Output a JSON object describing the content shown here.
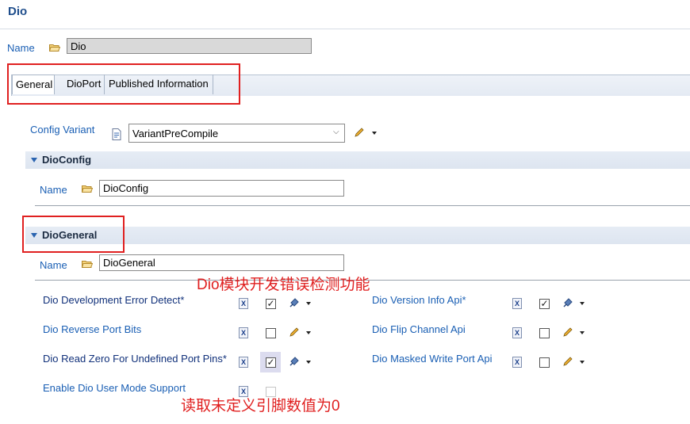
{
  "window": {
    "title": "Dio"
  },
  "name_field": {
    "label": "Name",
    "value": "Dio"
  },
  "tabs": [
    {
      "label": "General"
    },
    {
      "label": "DioPort"
    },
    {
      "label": "Published Information"
    }
  ],
  "config_variant": {
    "label": "Config Variant",
    "value": "VariantPreCompile"
  },
  "dioconfig": {
    "title": "DioConfig",
    "name_label": "Name",
    "name_value": "DioConfig"
  },
  "diogeneral": {
    "title": "DioGeneral",
    "name_label": "Name",
    "name_value": "DioGeneral"
  },
  "params": {
    "dev_error_detect": {
      "label": "Dio Development Error Detect*",
      "checked": true
    },
    "version_info_api": {
      "label": "Dio Version Info Api*",
      "checked": true
    },
    "reverse_port_bits": {
      "label": "Dio Reverse Port Bits",
      "checked": false
    },
    "flip_channel_api": {
      "label": "Dio Flip Channel Api",
      "checked": false
    },
    "read_zero": {
      "label": "Dio Read Zero For Undefined Port Pins*",
      "checked": true
    },
    "masked_write": {
      "label": "Dio Masked Write Port Api",
      "checked": false
    },
    "user_mode": {
      "label": "Enable Dio User Mode Support",
      "checked": false
    }
  },
  "annotations": {
    "top": "Dio模块开发错误检测功能",
    "bottom": "读取未定义引脚数值为0"
  },
  "icons": {
    "check": "✓",
    "dropdown": "⌵"
  },
  "colors": {
    "annotation": "#e02020",
    "link": "#1a5fb4"
  }
}
